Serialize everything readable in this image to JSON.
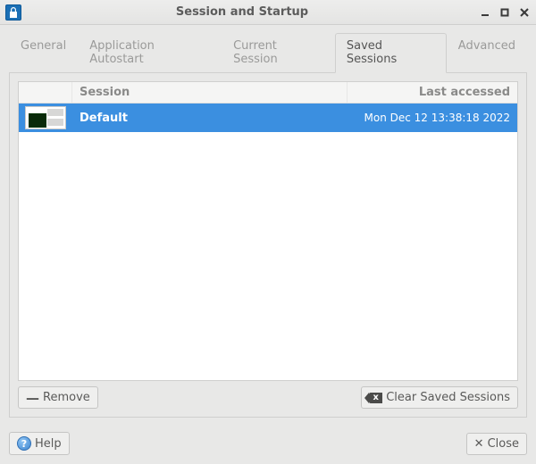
{
  "window": {
    "title": "Session and Startup"
  },
  "tabs": [
    {
      "label": "General"
    },
    {
      "label": "Application Autostart"
    },
    {
      "label": "Current Session"
    },
    {
      "label": "Saved Sessions"
    },
    {
      "label": "Advanced"
    }
  ],
  "active_tab_index": 3,
  "columns": {
    "name": "Session",
    "accessed": "Last accessed"
  },
  "sessions": [
    {
      "name": "Default",
      "last_accessed": "Mon Dec 12 13:38:18 2022",
      "selected": true
    }
  ],
  "buttons": {
    "remove": "Remove",
    "clear": "Clear Saved Sessions",
    "help": "Help",
    "close": "Close"
  }
}
